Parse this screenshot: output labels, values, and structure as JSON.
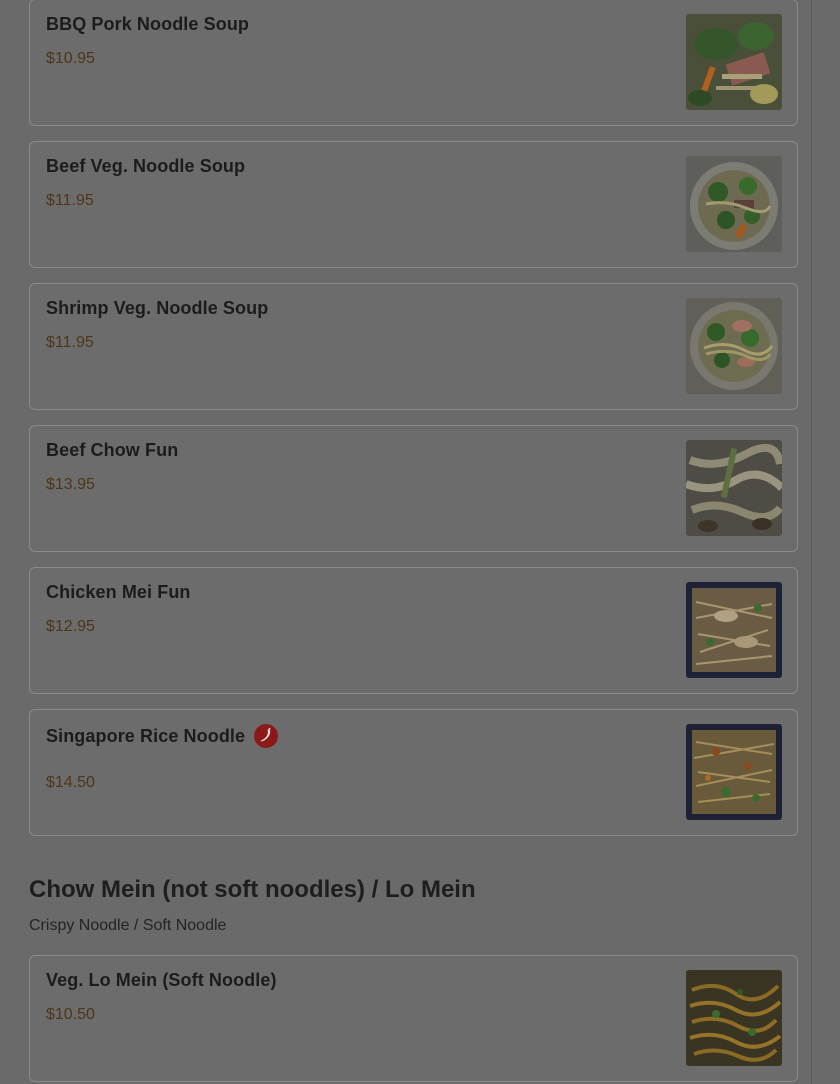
{
  "menu_items": [
    {
      "name": "BBQ Pork Noodle Soup",
      "price": "$10.95",
      "image": "bbq-pork-noodle-soup-photo"
    },
    {
      "name": "Beef Veg. Noodle Soup",
      "price": "$11.95",
      "image": "beef-veg-noodle-soup-photo"
    },
    {
      "name": "Shrimp Veg. Noodle Soup",
      "price": "$11.95",
      "image": "shrimp-veg-noodle-soup-photo"
    },
    {
      "name": "Beef Chow Fun",
      "price": "$13.95",
      "image": "beef-chow-fun-photo"
    },
    {
      "name": "Chicken Mei Fun",
      "price": "$12.95",
      "image": "chicken-mei-fun-photo"
    },
    {
      "name": "Singapore Rice Noodle",
      "price": "$14.50",
      "image": "singapore-rice-noodle-photo",
      "badge_icon": "spicy-chili-icon"
    }
  ],
  "section": {
    "title": "Chow Mein (not soft noodles) / Lo Mein",
    "subtitle": "Crispy Noodle / Soft Noodle",
    "items": [
      {
        "name": "Veg. Lo Mein (Soft Noodle)",
        "price": "$10.50",
        "image": "veg-lo-mein-photo"
      }
    ]
  },
  "colors": {
    "overlay_bg": "#6a6a6a",
    "card_border": "#8a8a8a",
    "price_text": "#4e3618",
    "spicy_badge": "#8a1a1a"
  }
}
